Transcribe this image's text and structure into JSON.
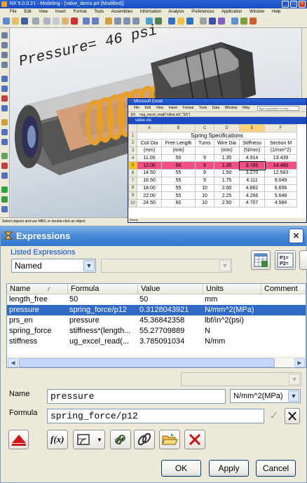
{
  "nx": {
    "title": "NX 5.0.0.21 - Modeling - [valve_demo.prt (Modified)]",
    "menu": [
      "File",
      "Edit",
      "View",
      "Insert",
      "Format",
      "Tools",
      "Assemblies",
      "Information",
      "Analysis",
      "Preferences",
      "Application",
      "Window",
      "Help"
    ],
    "viewport_label": "Pressure= 46 psi",
    "status": "Select objects and use MB3, or double-click an object"
  },
  "excel": {
    "title": "Microsoft Excel",
    "menu": [
      "File",
      "Edit",
      "View",
      "Insert",
      "Format",
      "Tools",
      "Data",
      "Window",
      "Help"
    ],
    "help_box": "Type a question for help",
    "cell_ref": "E5",
    "formula": "=ug_excel_read(\"valve.xls\",\"E5\")",
    "book": "valve.xls",
    "col_headers": [
      "A",
      "B",
      "C",
      "D",
      "E",
      "F"
    ],
    "table_title": "Spring Specifications",
    "headers": [
      "Coil Dia",
      "Free Length",
      "Turns",
      "Wire Dia",
      "Stiffness",
      "Section M"
    ],
    "units": [
      "(mm)",
      "(mm)",
      "",
      "(mm)",
      "(N/mm)",
      "(1/mm^2)"
    ],
    "rows": [
      [
        "11.00",
        "50",
        "9",
        "1.35",
        "4.914",
        "13.439"
      ],
      [
        "12.00",
        "50",
        "9",
        "1.35",
        "3.785",
        "14.460"
      ],
      [
        "14.50",
        "55",
        "9",
        "1.50",
        "3.270",
        "12.583"
      ],
      [
        "16.50",
        "55",
        "9",
        "1.75",
        "4.111",
        "9.049"
      ],
      [
        "18.00",
        "55",
        "10",
        "2.00",
        "4.862",
        "6.656"
      ],
      [
        "22.00",
        "55",
        "10",
        "2.25",
        "4.266",
        "5.648"
      ],
      [
        "24.50",
        "60",
        "10",
        "2.50",
        "4.707",
        "4.584"
      ]
    ],
    "row_numbers": [
      "1",
      "2",
      "3",
      "4",
      "5",
      "6",
      "7",
      "8",
      "9",
      "10"
    ],
    "selected_row": 1,
    "status": "Ready"
  },
  "dialog": {
    "title": "Expressions",
    "listed_label": "Listed Expressions",
    "listed_value": "Named",
    "columns": [
      "Name",
      "Formula",
      "Value",
      "Units",
      "Comment"
    ],
    "rows": [
      {
        "name": "length_free",
        "formula": "50",
        "value": "50",
        "units": "mm"
      },
      {
        "name": "pressure",
        "formula": "spring_force/p12",
        "value": "0.3128043921",
        "units": "N/mm^2(MPa)"
      },
      {
        "name": "prs_en",
        "formula": "pressure",
        "value": "45.36842358",
        "units": "lbf/in^2(psi)"
      },
      {
        "name": "spring_force",
        "formula": "stiffness*(length...",
        "value": "55.27709889",
        "units": "N"
      },
      {
        "name": "stiffness",
        "formula": "ug_excel_read(...",
        "value": "3.785091034",
        "units": "N/mm"
      }
    ],
    "name_label": "Name",
    "name_value": "pressure",
    "units_value": "N/mm^2(MPa)",
    "formula_label": "Formula",
    "formula_value": "spring_force/p12",
    "fx_label": "f(x)",
    "equation_icon": "P1=\nP2=",
    "ok": "OK",
    "apply": "Apply",
    "cancel": "Cancel"
  },
  "colors": {
    "selection": "#316ac5",
    "excel_selected_row": "#f04e86",
    "title_blue": "#3378cc"
  }
}
